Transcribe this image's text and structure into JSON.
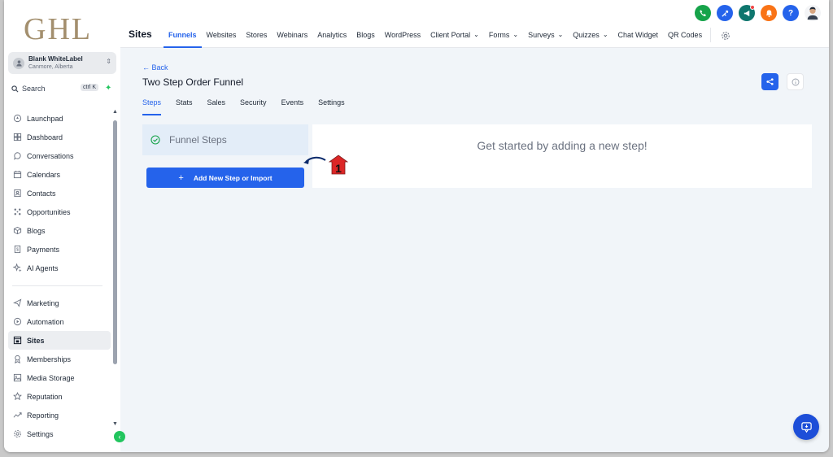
{
  "brand": {
    "logo_text": "GHL"
  },
  "account": {
    "name": "Blank WhiteLabel",
    "location": "Canmore, Alberta"
  },
  "search": {
    "placeholder": "Search",
    "shortcut": "ctrl K"
  },
  "sidebar": {
    "items": [
      {
        "label": "Launchpad",
        "icon": "rocket-icon"
      },
      {
        "label": "Dashboard",
        "icon": "dashboard-icon"
      },
      {
        "label": "Conversations",
        "icon": "chat-icon"
      },
      {
        "label": "Calendars",
        "icon": "calendar-icon"
      },
      {
        "label": "Contacts",
        "icon": "contacts-icon"
      },
      {
        "label": "Opportunities",
        "icon": "opportunities-icon"
      },
      {
        "label": "Blogs",
        "icon": "box-icon"
      },
      {
        "label": "Payments",
        "icon": "payments-icon"
      },
      {
        "label": "AI Agents",
        "icon": "sparkle-icon"
      }
    ],
    "items2": [
      {
        "label": "Marketing",
        "icon": "send-icon"
      },
      {
        "label": "Automation",
        "icon": "automation-icon"
      },
      {
        "label": "Sites",
        "icon": "sites-icon",
        "active": true
      },
      {
        "label": "Memberships",
        "icon": "memberships-icon"
      },
      {
        "label": "Media Storage",
        "icon": "image-icon"
      },
      {
        "label": "Reputation",
        "icon": "star-icon"
      },
      {
        "label": "Reporting",
        "icon": "chart-icon"
      },
      {
        "label": "Settings",
        "icon": "gear-icon"
      }
    ]
  },
  "header": {
    "section_title": "Sites",
    "tabs": [
      {
        "label": "Funnels",
        "active": true
      },
      {
        "label": "Websites"
      },
      {
        "label": "Stores"
      },
      {
        "label": "Webinars"
      },
      {
        "label": "Analytics"
      },
      {
        "label": "Blogs"
      },
      {
        "label": "WordPress"
      },
      {
        "label": "Client Portal",
        "dropdown": true
      },
      {
        "label": "Forms",
        "dropdown": true
      },
      {
        "label": "Surveys",
        "dropdown": true
      },
      {
        "label": "Quizzes",
        "dropdown": true
      },
      {
        "label": "Chat Widget"
      },
      {
        "label": "QR Codes"
      }
    ],
    "icons": {
      "phone_color": "#16a34a",
      "tools_color": "#2563eb",
      "megaphone_color": "#0f766e",
      "bell_color": "#f97316",
      "help_color": "#2563eb",
      "help_glyph": "?"
    }
  },
  "funnel": {
    "back_label": "← Back",
    "title": "Two Step Order Funnel",
    "tabs": [
      "Steps",
      "Stats",
      "Sales",
      "Security",
      "Events",
      "Settings"
    ],
    "active_tab": "Steps",
    "steps_heading": "Funnel Steps",
    "add_button_label": "Add New Step or Import",
    "empty_message": "Get started by adding a new step!"
  },
  "annotation": {
    "number": "1",
    "color": "#dc2626"
  },
  "colors": {
    "accent": "#2563eb",
    "success": "#22c55e"
  }
}
